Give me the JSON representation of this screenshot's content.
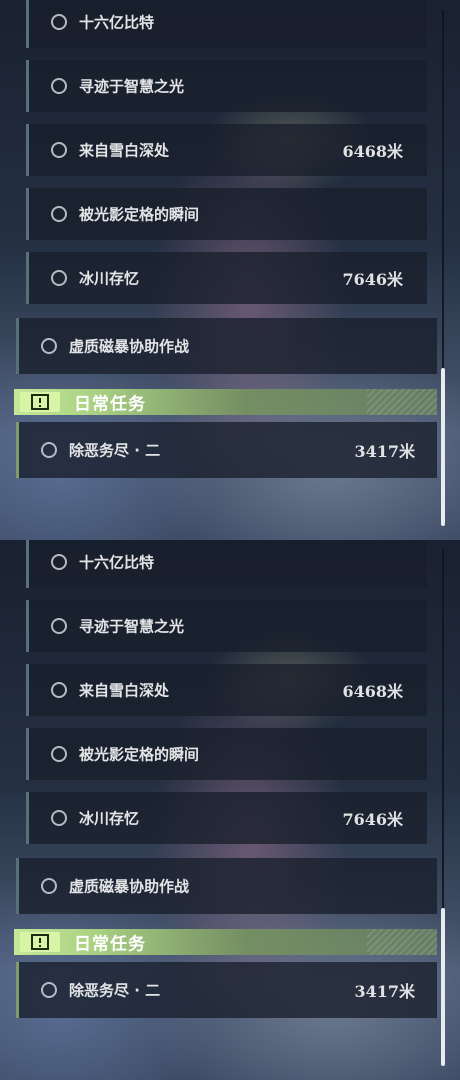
{
  "quests": {
    "sub": [
      {
        "name": "十六亿比特",
        "distance": ""
      },
      {
        "name": "寻迹于智慧之光",
        "distance": ""
      },
      {
        "name": "来自雪白深处",
        "distance": "6468米"
      },
      {
        "name": "被光影定格的瞬间",
        "distance": ""
      },
      {
        "name": "冰川存忆",
        "distance": "7646米"
      }
    ],
    "main": {
      "name": "虚质磁暴协助作战",
      "distance": ""
    },
    "daily_section": {
      "title": "日常任务",
      "icon": "exclamation-box-icon",
      "accent_color": "#c5e898"
    },
    "daily": [
      {
        "name": "除恶务尽 · 二",
        "distance": "3417米"
      }
    ]
  },
  "colors": {
    "accent": "#c5e898",
    "item_bg": "#181f2b",
    "text": "#e2e4e6"
  }
}
